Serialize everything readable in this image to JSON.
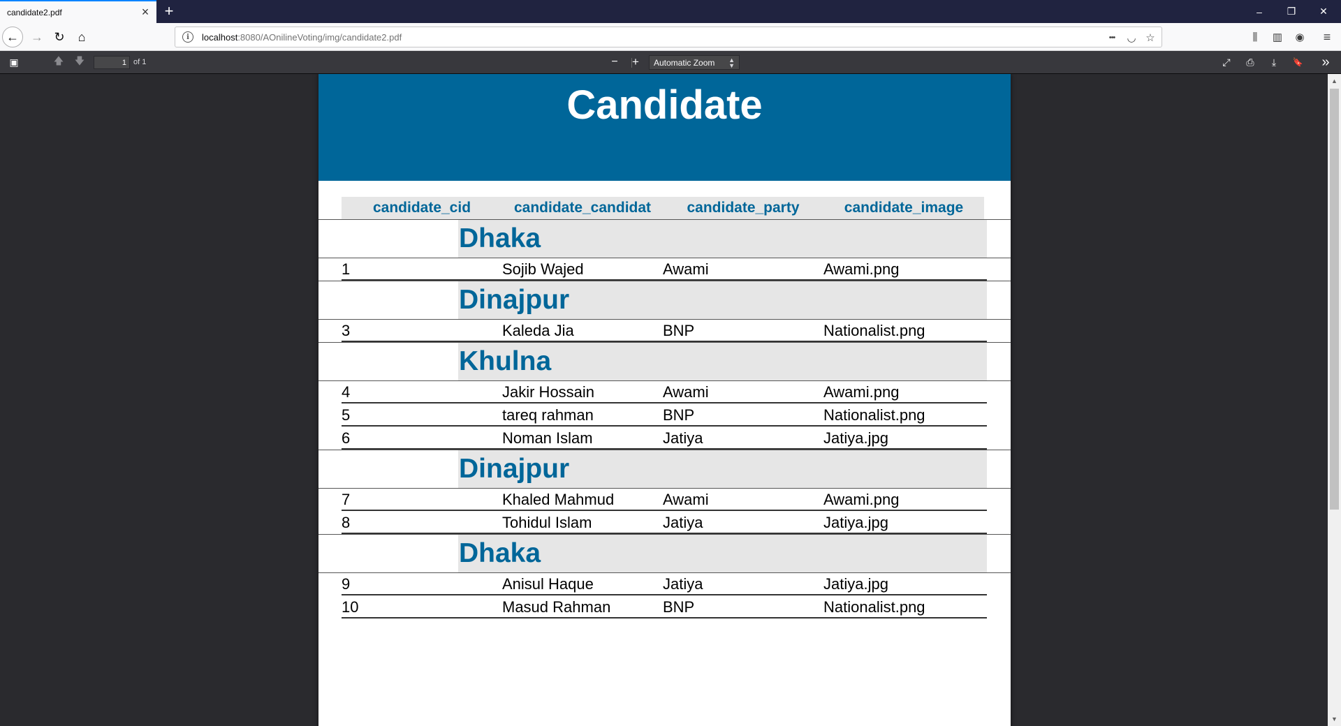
{
  "tab": {
    "title": "candidate2.pdf",
    "close_icon": "×",
    "new_tab_icon": "+"
  },
  "window": {
    "minimize": "–",
    "restore": "❐",
    "close": "✕"
  },
  "nav": {
    "back": "←",
    "forward": "→",
    "reload": "↻",
    "home": "⌂",
    "url_host": "localhost",
    "url_rest": ":8080/AOnilineVoting/img/candidate2.pdf",
    "info": "i",
    "more": "•••",
    "pocket": "◡",
    "bookmark": "☆",
    "library": "⫼",
    "sidebar": "▥",
    "account": "◉",
    "menu": "≡"
  },
  "pdf_toolbar": {
    "sidebar_toggle": "▣",
    "prev_page": "🡅",
    "next_page": "🡇",
    "page_number": "1",
    "page_count": "of 1",
    "zoom_out": "−",
    "zoom_in": "+",
    "zoom_value": "Automatic Zoom",
    "presentation": "⤢",
    "print": "⎙",
    "download": "⤓",
    "bookmark": "🔖",
    "tools": "»"
  },
  "report": {
    "title": "Candidate",
    "columns": [
      "candidate_cid",
      "candidate_candidat",
      "candidate_party",
      "candidate_image"
    ],
    "groups": [
      {
        "name": "Dhaka",
        "rows": [
          {
            "cid": "1",
            "name": "Sojib Wajed",
            "party": "Awami",
            "image": "Awami.png"
          }
        ]
      },
      {
        "name": "Dinajpur",
        "rows": [
          {
            "cid": "3",
            "name": "Kaleda Jia",
            "party": "BNP",
            "image": "Nationalist.png"
          }
        ]
      },
      {
        "name": "Khulna",
        "rows": [
          {
            "cid": "4",
            "name": "Jakir Hossain",
            "party": "Awami",
            "image": "Awami.png"
          },
          {
            "cid": "5",
            "name": "tareq rahman",
            "party": "BNP",
            "image": "Nationalist.png"
          },
          {
            "cid": "6",
            "name": "Noman Islam",
            "party": "Jatiya",
            "image": "Jatiya.jpg"
          }
        ]
      },
      {
        "name": "Dinajpur",
        "rows": [
          {
            "cid": "7",
            "name": "Khaled Mahmud",
            "party": "Awami",
            "image": "Awami.png"
          },
          {
            "cid": "8",
            "name": "Tohidul Islam",
            "party": "Jatiya",
            "image": "Jatiya.jpg"
          }
        ]
      },
      {
        "name": "Dhaka",
        "rows": [
          {
            "cid": "9",
            "name": "Anisul Haque",
            "party": "Jatiya",
            "image": "Jatiya.jpg"
          },
          {
            "cid": "10",
            "name": "Masud Rahman",
            "party": "BNP",
            "image": "Nationalist.png"
          }
        ]
      }
    ]
  },
  "colors": {
    "header_bg": "#006699",
    "band_bg": "#e6e6e6",
    "tabbar_bg": "#202340"
  }
}
